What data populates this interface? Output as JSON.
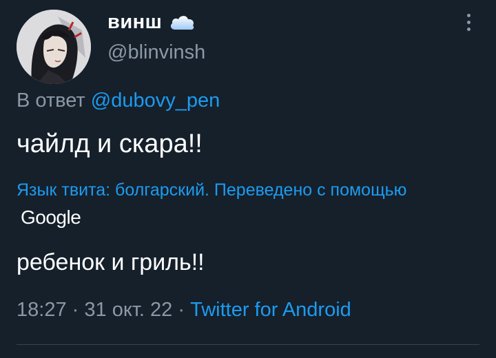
{
  "author": {
    "display_name": "винш",
    "badge_icon": "cloud-icon",
    "handle": "@blinvinsh"
  },
  "reply": {
    "prefix": "В ответ",
    "mention": "@dubovy_pen"
  },
  "tweet": {
    "text": "чайлд и скара!!"
  },
  "translation": {
    "note": "Язык твита: болгарский. Переведено с помощью",
    "provider": "Google",
    "text": "ребенок и гриль!!"
  },
  "meta": {
    "time": "18:27",
    "separator": "·",
    "date": "31 окт. 22",
    "source": "Twitter for Android"
  },
  "colors": {
    "background": "#15202b",
    "accent": "#1d9bf0",
    "secondary_text": "#8b98a5",
    "primary_text": "#ffffff",
    "divider": "#38444d"
  }
}
